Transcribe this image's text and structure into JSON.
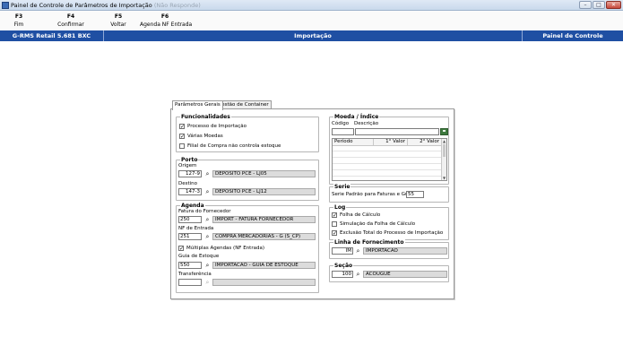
{
  "window": {
    "title": "Painel de Controle de Parâmetros de Importação",
    "title_ghost": "(Não Responde)",
    "buttons": {
      "minimize": "–",
      "maximize": "□",
      "close": "✕"
    }
  },
  "fkeys": [
    {
      "key": "F3",
      "label": "Fim"
    },
    {
      "key": "F4",
      "label": "Confirmar"
    },
    {
      "key": "F5",
      "label": "Voltar"
    },
    {
      "key": "F6",
      "label": "Agenda NF Entrada"
    }
  ],
  "header": {
    "left": "G-RMS Retail 5.681 BXC",
    "center": "Importação",
    "right": "Painel de Controle"
  },
  "tabs": [
    {
      "label": "Parâmetros Gerais",
      "active": true
    },
    {
      "label": "Gestão de Container",
      "active": false
    }
  ],
  "funcionalidades": {
    "title": "Funcionalidades",
    "items": [
      {
        "label": "Processo de Importação",
        "checked": true
      },
      {
        "label": "Várias Moedas",
        "checked": true
      },
      {
        "label": "Filial de Compra não controla estoque",
        "checked": false
      }
    ]
  },
  "porto": {
    "title": "Porto",
    "origem": {
      "label": "Origem",
      "code": "127-9",
      "desc": "DEPOSITO PCE - LJ05"
    },
    "destino": {
      "label": "Destino",
      "code": "147-3",
      "desc": "DEPOSITO PCE - LJ12"
    }
  },
  "agenda": {
    "title": "Agenda",
    "fatura": {
      "label": "Fatura do Fornecedor",
      "code": "250",
      "desc": "IMPORT - FATURA FORNECEDOR"
    },
    "nf": {
      "label": "NF de Entrada",
      "code": "251",
      "desc": "COMPRA MERCADORIAS - G (S_CP)"
    },
    "multiplas": {
      "label": "Múltiplas Agendas (NF Entrada)",
      "checked": true
    },
    "guia": {
      "label": "Guia de Estoque",
      "code": "550",
      "desc": "IMPORTACAO - GUIA DE ESTOQUE"
    },
    "transferencia": {
      "label": "Transferência",
      "code": "",
      "desc": ""
    }
  },
  "moeda": {
    "title": "Moeda / Índice",
    "codigo_label": "Código",
    "descricao_label": "Descrição",
    "codigo": "",
    "descricao": "",
    "grid_headers": [
      "Período",
      "1° Valor",
      "2° Valor"
    ]
  },
  "serie": {
    "title": "Serie",
    "label": "Serie Padrão para Faturas e Guias:",
    "value": "55"
  },
  "log": {
    "title": "Log",
    "items": [
      {
        "label": "Folha de Cálculo",
        "checked": true
      },
      {
        "label": "Simulação da Folha de Cálculo",
        "checked": false
      },
      {
        "label": "Exclusão Total do Processo de Importação",
        "checked": true
      }
    ]
  },
  "linha": {
    "title": "Linha de Fornecimento",
    "code": "IM",
    "desc": "IMPORTACAO"
  },
  "secao": {
    "title": "Seção",
    "code": "100",
    "desc": "ACOUGUE"
  },
  "icons": {
    "lookup": "binoculars-icon",
    "save": "save-icon",
    "check": "✓"
  }
}
